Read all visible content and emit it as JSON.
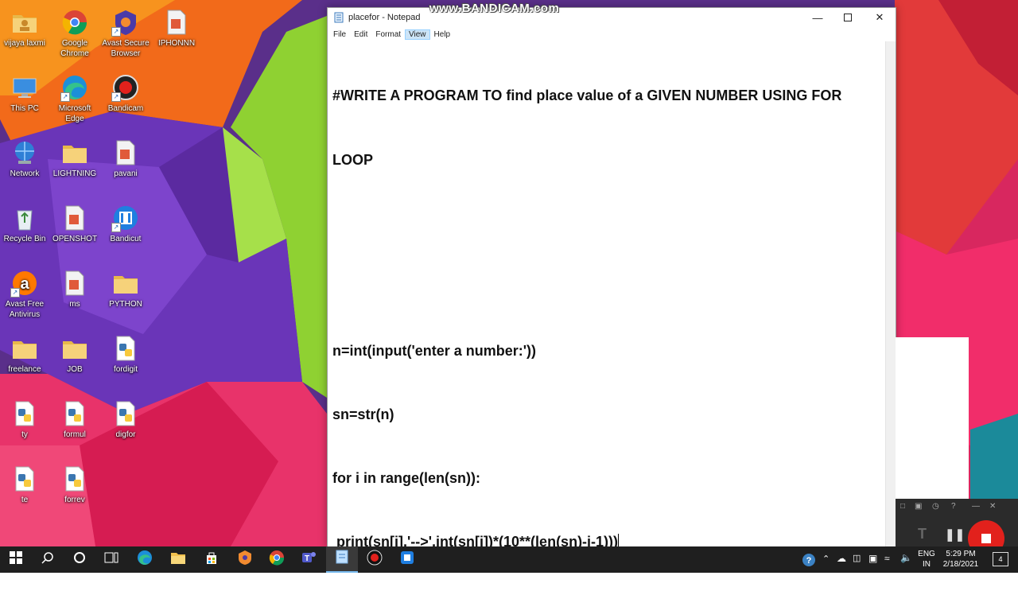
{
  "watermark": "www.BANDICAM.com",
  "desktop": {
    "icons": [
      {
        "label": "vijaya laxmi",
        "icon": "user-folder-icon"
      },
      {
        "label": "Google Chrome",
        "icon": "chrome-icon"
      },
      {
        "label": "Avast Secure Browser",
        "icon": "avast-browser-icon"
      },
      {
        "label": "IPHONNN",
        "icon": "document-icon"
      },
      {
        "label": "This PC",
        "icon": "computer-icon"
      },
      {
        "label": "Microsoft Edge",
        "icon": "edge-icon"
      },
      {
        "label": "Bandicam",
        "icon": "bandicam-icon"
      },
      {
        "label": "Network",
        "icon": "network-icon"
      },
      {
        "label": "LIGHTNING",
        "icon": "folder-icon"
      },
      {
        "label": "pavani",
        "icon": "document-icon"
      },
      {
        "label": "Recycle Bin",
        "icon": "recycle-bin-icon"
      },
      {
        "label": "OPENSHOT",
        "icon": "document-icon"
      },
      {
        "label": "Bandicut",
        "icon": "bandicut-icon"
      },
      {
        "label": "Avast Free Antivirus",
        "icon": "avast-icon"
      },
      {
        "label": "ms",
        "icon": "document-icon"
      },
      {
        "label": "PYTHON",
        "icon": "folder-icon"
      },
      {
        "label": "freelance",
        "icon": "folder-icon"
      },
      {
        "label": "JOB",
        "icon": "folder-icon"
      },
      {
        "label": "fordigit",
        "icon": "python-file-icon"
      },
      {
        "label": "ty",
        "icon": "python-file-icon"
      },
      {
        "label": "formul",
        "icon": "python-file-icon"
      },
      {
        "label": "digfor",
        "icon": "python-file-icon"
      },
      {
        "label": "te",
        "icon": "python-file-icon"
      },
      {
        "label": "forrev",
        "icon": "python-file-icon"
      }
    ]
  },
  "notepad": {
    "title": "placefor - Notepad",
    "menu": [
      "File",
      "Edit",
      "Format",
      "View",
      "Help"
    ],
    "active_menu": "View",
    "lines": [
      "#WRITE A PROGRAM TO find place value of a GIVEN NUMBER USING FOR",
      "LOOP",
      "",
      "",
      "n=int(input('enter a number:'))",
      "sn=str(n)",
      "for i in range(len(sn)):",
      " print(sn[i],'-->',int(sn[i])*(10**(len(sn)-i-1)))"
    ]
  },
  "taskbar": {
    "apps": [
      "windows-start-icon",
      "search-icon",
      "cortana-icon",
      "task-view-icon",
      "edge-icon",
      "file-explorer-icon",
      "store-icon",
      "avast-browser-icon",
      "chrome-icon",
      "teams-icon",
      "notepad-icon",
      "bandicam-icon",
      "bandicut-icon"
    ],
    "active_app": "notepad-icon",
    "language": "ENG",
    "region": "IN",
    "time": "5:29 PM",
    "date": "2/18/2021",
    "notification_count": "4"
  },
  "colors": {
    "taskbar": "#1f1f1f",
    "menu_highlight": "#cce4f7",
    "record_button": "#e2211c"
  }
}
